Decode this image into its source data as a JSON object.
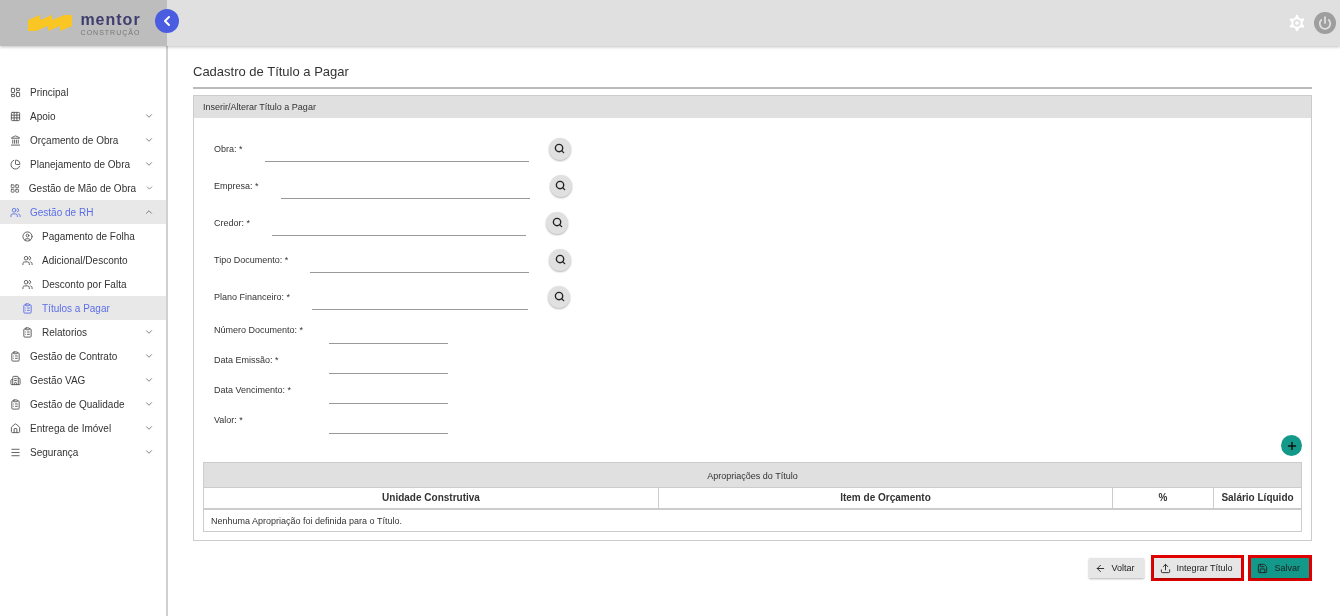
{
  "logo": {
    "name": "mentor",
    "tagline": "CONSTRUÇÃO"
  },
  "sidebar": {
    "items": [
      {
        "label": "Principal",
        "expandable": false,
        "expanded": false,
        "selected": false
      },
      {
        "label": "Apoio",
        "expandable": true,
        "expanded": false,
        "selected": false
      },
      {
        "label": "Orçamento de Obra",
        "expandable": true,
        "expanded": false,
        "selected": false
      },
      {
        "label": "Planejamento de Obra",
        "expandable": true,
        "expanded": false,
        "selected": false
      },
      {
        "label": "Gestão de Mão de Obra",
        "expandable": true,
        "expanded": false,
        "selected": false
      },
      {
        "label": "Gestão de RH",
        "expandable": true,
        "expanded": true,
        "selected": true,
        "children": [
          {
            "label": "Pagamento de Folha",
            "expandable": false,
            "expanded": false,
            "selected": false
          },
          {
            "label": "Adicional/Desconto",
            "expandable": false,
            "expanded": false,
            "selected": false
          },
          {
            "label": "Desconto por Falta",
            "expandable": false,
            "expanded": false,
            "selected": false
          },
          {
            "label": "Títulos a Pagar",
            "expandable": false,
            "expanded": false,
            "selected": true
          },
          {
            "label": "Relatorios",
            "expandable": true,
            "expanded": false,
            "selected": false
          }
        ]
      },
      {
        "label": "Gestão de Contrato",
        "expandable": true,
        "expanded": false,
        "selected": false
      },
      {
        "label": "Gestão VAG",
        "expandable": true,
        "expanded": false,
        "selected": false
      },
      {
        "label": "Gestão de Qualidade",
        "expandable": true,
        "expanded": false,
        "selected": false
      },
      {
        "label": "Entrega de Imóvel",
        "expandable": true,
        "expanded": false,
        "selected": false
      },
      {
        "label": "Segurança",
        "expandable": true,
        "expanded": false,
        "selected": false
      }
    ]
  },
  "page_title": "Cadastro de Título a Pagar",
  "panel": {
    "title": "Inserir/Alterar Título a Pagar",
    "fields": [
      {
        "label": "Obra:",
        "required": "*",
        "kind": "lookup"
      },
      {
        "label": "Empresa:",
        "required": "*",
        "kind": "lookup"
      },
      {
        "label": "Credor:",
        "required": "*",
        "kind": "lookup"
      },
      {
        "label": "Tipo Documento:",
        "required": "*",
        "kind": "lookup"
      },
      {
        "label": "Plano Financeiro:",
        "required": "*",
        "kind": "lookup"
      },
      {
        "label": "Número Documento:",
        "required": "*",
        "kind": "text"
      },
      {
        "label": "Data Emissão:",
        "required": "*",
        "kind": "text"
      },
      {
        "label": "Data Vencimento:",
        "required": "*",
        "kind": "text"
      },
      {
        "label": "Valor:",
        "required": "*",
        "kind": "text"
      }
    ],
    "table": {
      "title": "Apropriações do Título",
      "columns": [
        "Unidade Construtiva",
        "Item de Orçamento",
        "%",
        "Salário Líquido"
      ],
      "empty_message": "Nenhuma Apropriação foi definida para o Título."
    }
  },
  "buttons": [
    {
      "label": "Voltar",
      "kind": "back",
      "highlighted": false
    },
    {
      "label": "Integrar Título",
      "kind": "upload",
      "highlighted": true
    },
    {
      "label": "Salvar",
      "kind": "save",
      "highlighted": true
    }
  ]
}
